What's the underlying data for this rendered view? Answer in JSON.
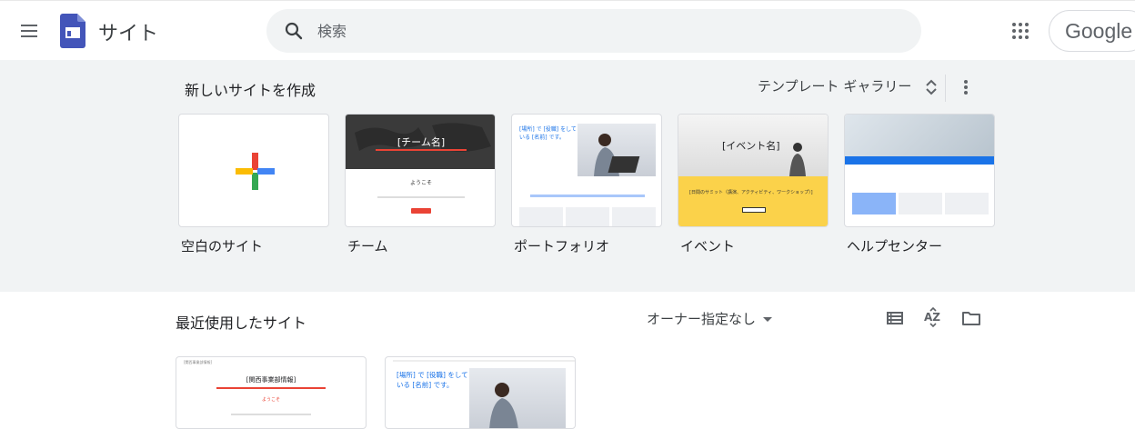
{
  "header": {
    "app_title": "サイト",
    "search_placeholder": "検索",
    "account_label": "Google"
  },
  "create": {
    "title": "新しいサイトを作成",
    "gallery_label": "テンプレート ギャラリー",
    "templates": [
      {
        "label": "空白のサイト"
      },
      {
        "label": "チーム",
        "thumb_title": "[チーム名]",
        "thumb_welcome": "ようこそ"
      },
      {
        "label": "ポートフォリオ",
        "thumb_title": "[場所] で [役職] をしている [名前] です。"
      },
      {
        "label": "イベント",
        "thumb_title": "[イベント名]",
        "thumb_sub": "[日間のサミット（講演、アクティビティ、ワークショップ）]"
      },
      {
        "label": "ヘルプセンター"
      }
    ]
  },
  "recent": {
    "title": "最近使用したサイト",
    "owner_filter": "オーナー指定なし",
    "sites": [
      {
        "thumb_header": "[関西事業部情報]",
        "thumb_title": "[関西事業部情報]",
        "thumb_welcome": "ようこそ"
      },
      {
        "thumb_title": "[場所] で [役職] をしている [名前] です。"
      }
    ]
  },
  "colors": {
    "google_blue": "#4285f4",
    "google_red": "#ea4335",
    "google_yellow": "#fbbc04",
    "google_green": "#34a853",
    "sites_purple": "#4355b9",
    "event_yellow": "#fbd24a",
    "team_dark": "#3a3a3a"
  }
}
